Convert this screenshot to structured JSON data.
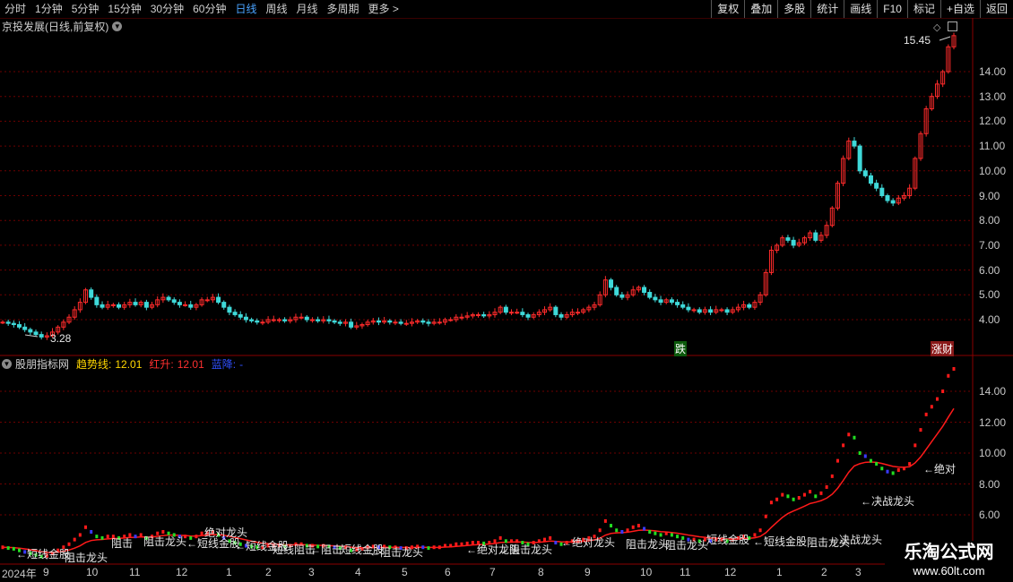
{
  "toolbar": {
    "timeframes": [
      "分时",
      "1分钟",
      "5分钟",
      "15分钟",
      "30分钟",
      "60分钟",
      "日线",
      "周线",
      "月线",
      "多周期",
      "更多 >"
    ],
    "buttons": [
      "复权",
      "叠加",
      "多股",
      "统计",
      "画线",
      "F10",
      "标记",
      "+自选",
      "返回"
    ]
  },
  "main_panel": {
    "title": "京投发展(日线,前复权)",
    "high_label": "15.45",
    "low_label": "3.28",
    "signal_down": "跌",
    "signal_up": "涨财",
    "y_ticks": [
      "14.00",
      "13.00",
      "12.00",
      "11.00",
      "10.00",
      "9.00",
      "8.00",
      "7.00",
      "6.00",
      "5.00",
      "4.00"
    ]
  },
  "indicator_panel": {
    "name": "股朋指标网",
    "trend_label": "趋势线:",
    "trend_value": "12.01",
    "red_label": "红升:",
    "red_value": "12.01",
    "blue_label": "蓝降:",
    "blue_value": "-",
    "y_ticks": [
      "14.00",
      "12.00",
      "10.00",
      "8.00",
      "6.00"
    ],
    "annotations": [
      "←短线金股",
      "阻击龙头",
      "阻击",
      "阻击龙头",
      "←短线金股",
      "绝对龙头",
      "←短线金股",
      "短线阻击",
      "←阻击",
      "短线金股",
      "←阻击龙头",
      "←绝对龙头",
      "←阻击龙头",
      "←绝对龙头",
      "阻击龙头",
      "阻击龙头",
      "短线金股",
      "←短线金股",
      "阻击龙头",
      "←决战龙头",
      "←决战龙头",
      "←绝对"
    ]
  },
  "x_axis": [
    "2024年",
    "9",
    "10",
    "11",
    "12",
    "1",
    "2",
    "3",
    "4",
    "5",
    "6",
    "7",
    "8",
    "9",
    "10",
    "11",
    "12",
    "1",
    "2",
    "3"
  ],
  "watermark": {
    "line1": "乐淘公式网",
    "line2": "www.60lt.com"
  },
  "colors": {
    "up": "#ff2b2b",
    "down": "#3fd9d9",
    "grid": "#6e0000",
    "trend_red": "#ff1a1a",
    "trend_blue": "#3a3aff",
    "trend_green": "#22dd22"
  },
  "chart_data": {
    "type": "candlestick",
    "title": "京投发展(日线,前复权)",
    "y_range": [
      3.0,
      16.0
    ],
    "closes": [
      3.9,
      3.85,
      3.8,
      3.7,
      3.6,
      3.5,
      3.4,
      3.3,
      3.35,
      3.5,
      3.7,
      3.9,
      4.1,
      4.4,
      4.7,
      5.2,
      4.9,
      4.6,
      4.5,
      4.6,
      4.6,
      4.5,
      4.6,
      4.7,
      4.6,
      4.7,
      4.5,
      4.6,
      4.8,
      4.9,
      4.8,
      4.7,
      4.6,
      4.6,
      4.5,
      4.6,
      4.8,
      4.8,
      4.9,
      4.7,
      4.5,
      4.3,
      4.2,
      4.1,
      4.0,
      3.95,
      3.9,
      3.9,
      4.0,
      4.0,
      4.0,
      3.95,
      4.0,
      4.1,
      4.1,
      4.0,
      4.0,
      3.95,
      4.0,
      3.95,
      3.9,
      3.85,
      3.9,
      3.7,
      3.75,
      3.8,
      3.9,
      3.95,
      3.9,
      3.95,
      3.9,
      3.9,
      3.85,
      3.85,
      3.9,
      3.95,
      3.9,
      3.85,
      3.9,
      3.9,
      4.0,
      4.0,
      4.1,
      4.1,
      4.15,
      4.2,
      4.2,
      4.15,
      4.2,
      4.3,
      4.5,
      4.3,
      4.3,
      4.3,
      4.2,
      4.1,
      4.2,
      4.3,
      4.4,
      4.5,
      4.2,
      4.1,
      4.2,
      4.3,
      4.3,
      4.4,
      4.5,
      4.6,
      5.0,
      5.6,
      5.3,
      5.0,
      4.9,
      5.0,
      5.2,
      5.3,
      5.1,
      4.9,
      4.8,
      4.7,
      4.8,
      4.7,
      4.6,
      4.5,
      4.4,
      4.4,
      4.3,
      4.4,
      4.3,
      4.4,
      4.4,
      4.3,
      4.4,
      4.5,
      4.6,
      4.5,
      4.7,
      5.0,
      5.9,
      6.8,
      7.0,
      7.3,
      7.2,
      7.0,
      7.1,
      7.3,
      7.5,
      7.2,
      7.4,
      7.8,
      8.5,
      9.5,
      10.5,
      11.2,
      11.0,
      10.0,
      9.8,
      9.5,
      9.3,
      9.0,
      8.8,
      8.7,
      8.9,
      9.0,
      9.3,
      10.5,
      11.5,
      12.5,
      13.0,
      13.5,
      14.0,
      15.0,
      15.45
    ],
    "trend_line": {
      "name": "趋势线",
      "last": 12.01
    }
  }
}
